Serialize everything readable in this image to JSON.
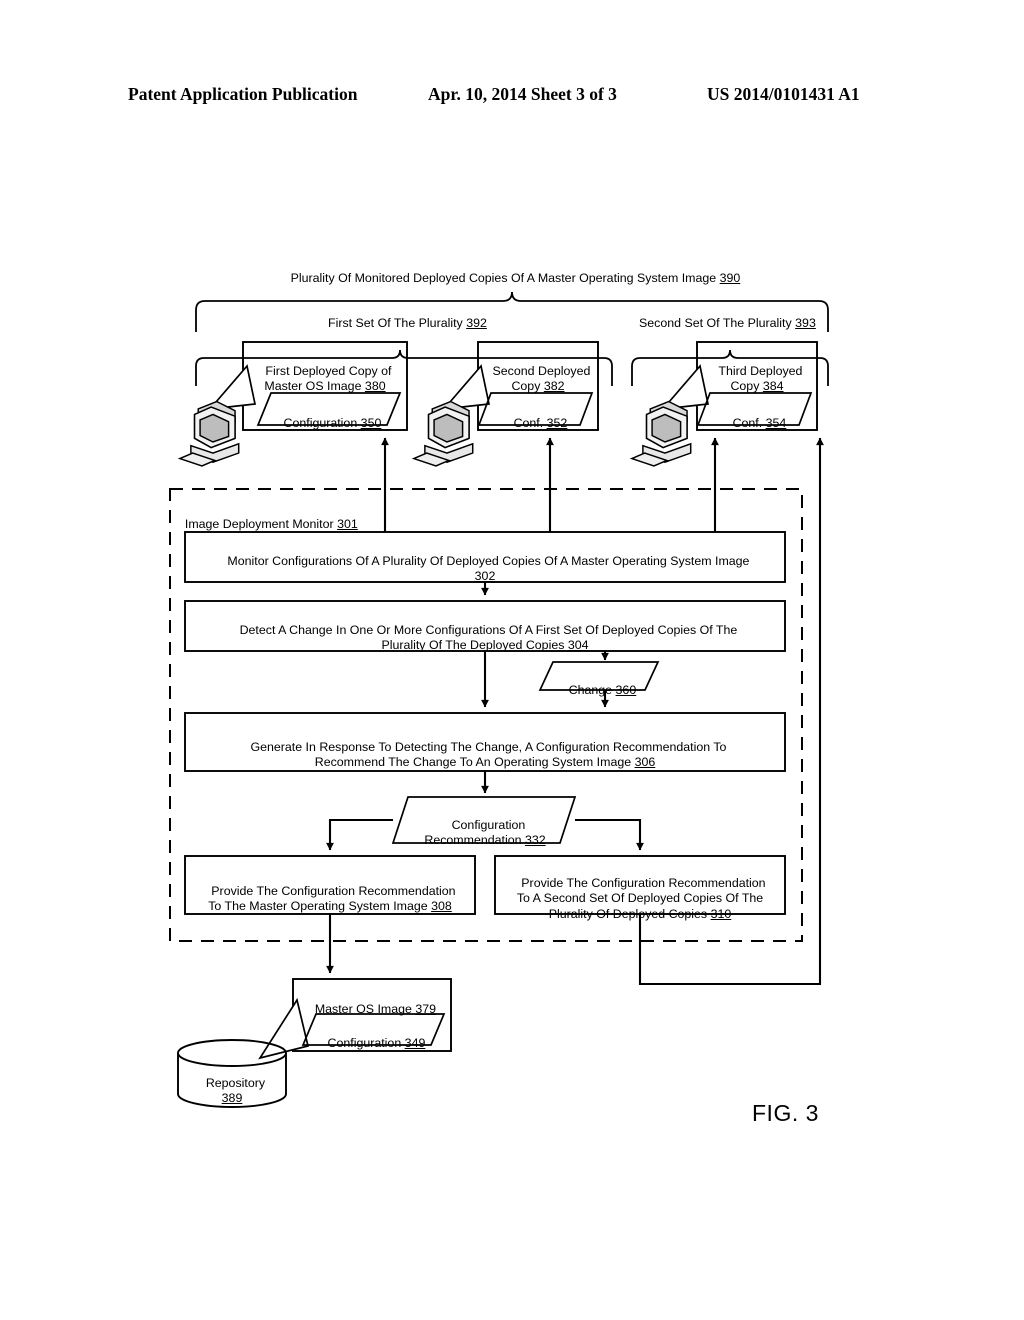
{
  "header": {
    "title": "Patent Application Publication",
    "date_sheet": "Apr. 10, 2014  Sheet 3 of 3",
    "publication_number": "US 2014/0101431 A1"
  },
  "figure": {
    "label": "FIG. 3",
    "braces": {
      "plurality": {
        "text": "Plurality Of Monitored Deployed Copies Of A Master Operating System Image ",
        "ref": "390"
      },
      "first_set": {
        "text": "First Set Of The Plurality ",
        "ref": "392"
      },
      "second_set": {
        "text": "Second Set Of The Plurality ",
        "ref": "393"
      }
    },
    "deployed_copies": [
      {
        "title": "First Deployed Copy of\nMaster OS Image ",
        "title_ref": "380",
        "config": "Configuration ",
        "config_ref": "350",
        "icon": "desktop-computer-icon"
      },
      {
        "title": "Second Deployed\nCopy ",
        "title_ref": "382",
        "config": "Conf. ",
        "config_ref": "352",
        "icon": "desktop-computer-icon"
      },
      {
        "title": "Third Deployed\nCopy ",
        "title_ref": "384",
        "config": "Conf. ",
        "config_ref": "354",
        "icon": "desktop-computer-icon"
      }
    ],
    "monitor": {
      "title": "Image Deployment Monitor ",
      "title_ref": "301",
      "steps": [
        {
          "text": "Monitor Configurations Of A Plurality Of Deployed Copies Of A Master Operating System Image\n",
          "ref": "302"
        },
        {
          "text": "Detect A Change In One Or More Configurations Of A First Set Of Deployed Copies Of The\nPlurality Of The Deployed Copies ",
          "ref": "304"
        },
        {
          "text": "Generate In Response To Detecting The Change, A Configuration Recommendation To\nRecommend The Change To An Operating System Image ",
          "ref": "306"
        },
        {
          "text": "Provide The Configuration Recommendation\nTo The Master Operating System Image ",
          "ref": "308"
        },
        {
          "text": "Provide The Configuration Recommendation\nTo A Second Set Of Deployed Copies Of The\nPlurality Of Deployed Copies ",
          "ref": "310"
        }
      ],
      "data_items": [
        {
          "text": "Change ",
          "ref": "360"
        },
        {
          "text": "Configuration\nRecommendation ",
          "ref": "332"
        }
      ]
    },
    "master_image": {
      "title": "Master OS Image ",
      "title_ref": "379",
      "config": "Configuration ",
      "config_ref": "349"
    },
    "repository": {
      "text": "Repository\n",
      "ref": "389"
    }
  }
}
